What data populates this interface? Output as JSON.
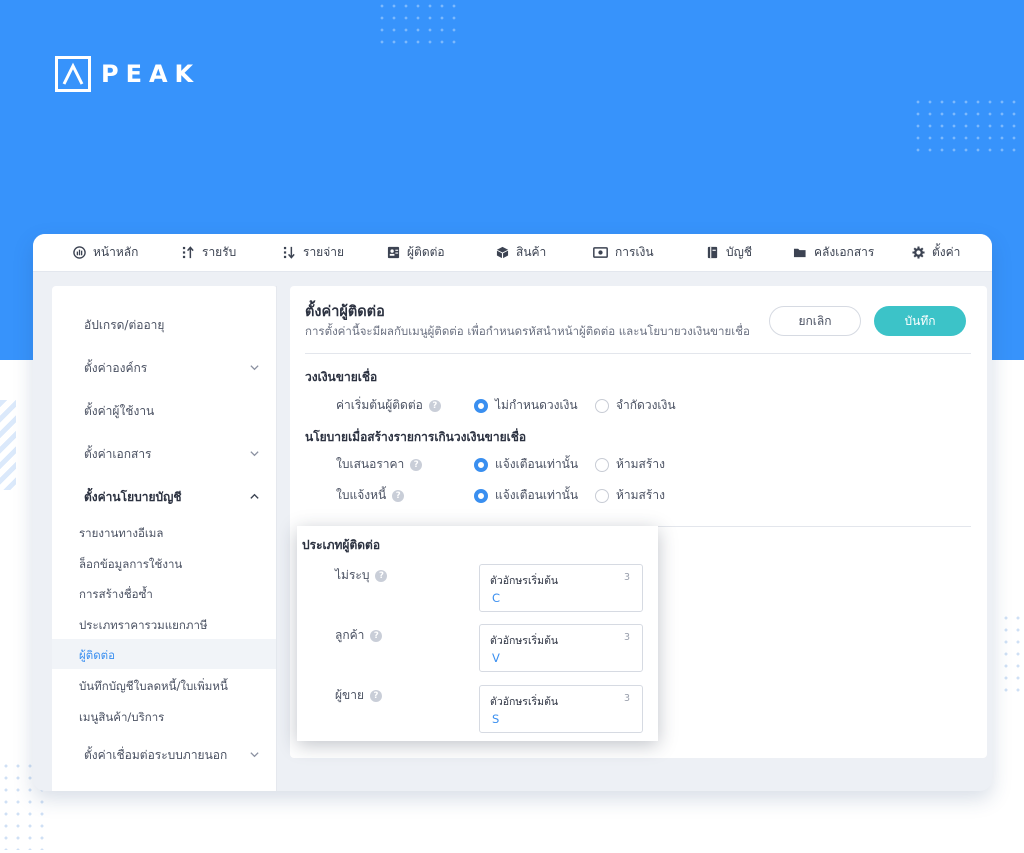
{
  "brand": {
    "logo_text": "PEAK"
  },
  "colors": {
    "hero": "#3793fb",
    "accent": "#3a8ff0",
    "save": "#3cc3c8"
  },
  "topnav": {
    "items": [
      {
        "label": "หน้าหลัก",
        "icon": "dashboard-icon"
      },
      {
        "label": "รายรับ",
        "icon": "income-icon"
      },
      {
        "label": "รายจ่าย",
        "icon": "expense-icon"
      },
      {
        "label": "ผู้ติดต่อ",
        "icon": "contact-icon"
      },
      {
        "label": "สินค้า",
        "icon": "box-icon"
      },
      {
        "label": "การเงิน",
        "icon": "money-icon"
      },
      {
        "label": "บัญชี",
        "icon": "ledger-icon"
      },
      {
        "label": "คลังเอกสาร",
        "icon": "folder-icon"
      },
      {
        "label": "ตั้งค่า",
        "icon": "gear-icon"
      }
    ]
  },
  "sidebar": {
    "items": [
      {
        "label": "อัปเกรด/ต่ออายุ"
      },
      {
        "label": "ตั้งค่าองค์กร"
      },
      {
        "label": "ตั้งค่าผู้ใช้งาน"
      },
      {
        "label": "ตั้งค่าเอกสาร"
      },
      {
        "label": "ตั้งค่านโยบายบัญชี"
      }
    ],
    "sub_items": [
      {
        "label": "รายงานทางอีเมล"
      },
      {
        "label": "ล็อกข้อมูลการใช้งาน"
      },
      {
        "label": "การสร้างชื่อซ้ำ"
      },
      {
        "label": "ประเภทราคารวมแยกภาษี"
      },
      {
        "label": "ผู้ติดต่อ"
      },
      {
        "label": "บันทึกบัญชีใบลดหนี้/ใบเพิ่มหนี้"
      },
      {
        "label": "เมนูสินค้า/บริการ"
      }
    ],
    "bottom_item": {
      "label": "ตั้งค่าเชื่อมต่อระบบภายนอก"
    }
  },
  "main": {
    "title": "ตั้งค่าผู้ติดต่อ",
    "description": "การตั้งค่านี้จะมีผลกับเมนูผู้ติดต่อ เพื่อกำหนดรหัสนำหน้าผู้ติดต่อ และนโยบายวงเงินขายเชื่อ",
    "cancel_label": "ยกเลิก",
    "save_label": "บันทึก",
    "credit_section": {
      "title": "วงเงินขายเชื่อ",
      "row_label": "ค่าเริ่มต้นผู้ติดต่อ",
      "option_selected": "ไม่กำหนดวงเงิน",
      "option_other": "จำกัดวงเงิน"
    },
    "policy_section": {
      "title": "นโยบายเมื่อสร้างรายการเกินวงเงินขายเชื่อ",
      "rows": [
        {
          "label": "ใบเสนอราคา",
          "option_selected": "แจ้งเตือนเท่านั้น",
          "option_other": "ห้ามสร้าง"
        },
        {
          "label": "ใบแจ้งหนี้",
          "option_selected": "แจ้งเตือนเท่านั้น",
          "option_other": "ห้ามสร้าง"
        }
      ]
    }
  },
  "contact_types": {
    "title": "ประเภทผู้ติดต่อ",
    "rows": [
      {
        "label": "ไม่ระบุ",
        "field_label": "ตัวอักษรเริ่มต้น",
        "count": "3",
        "value": "C"
      },
      {
        "label": "ลูกค้า",
        "field_label": "ตัวอักษรเริ่มต้น",
        "count": "3",
        "value": "V"
      },
      {
        "label": "ผู้ขาย",
        "field_label": "ตัวอักษรเริ่มต้น",
        "count": "3",
        "value": "S"
      }
    ]
  }
}
